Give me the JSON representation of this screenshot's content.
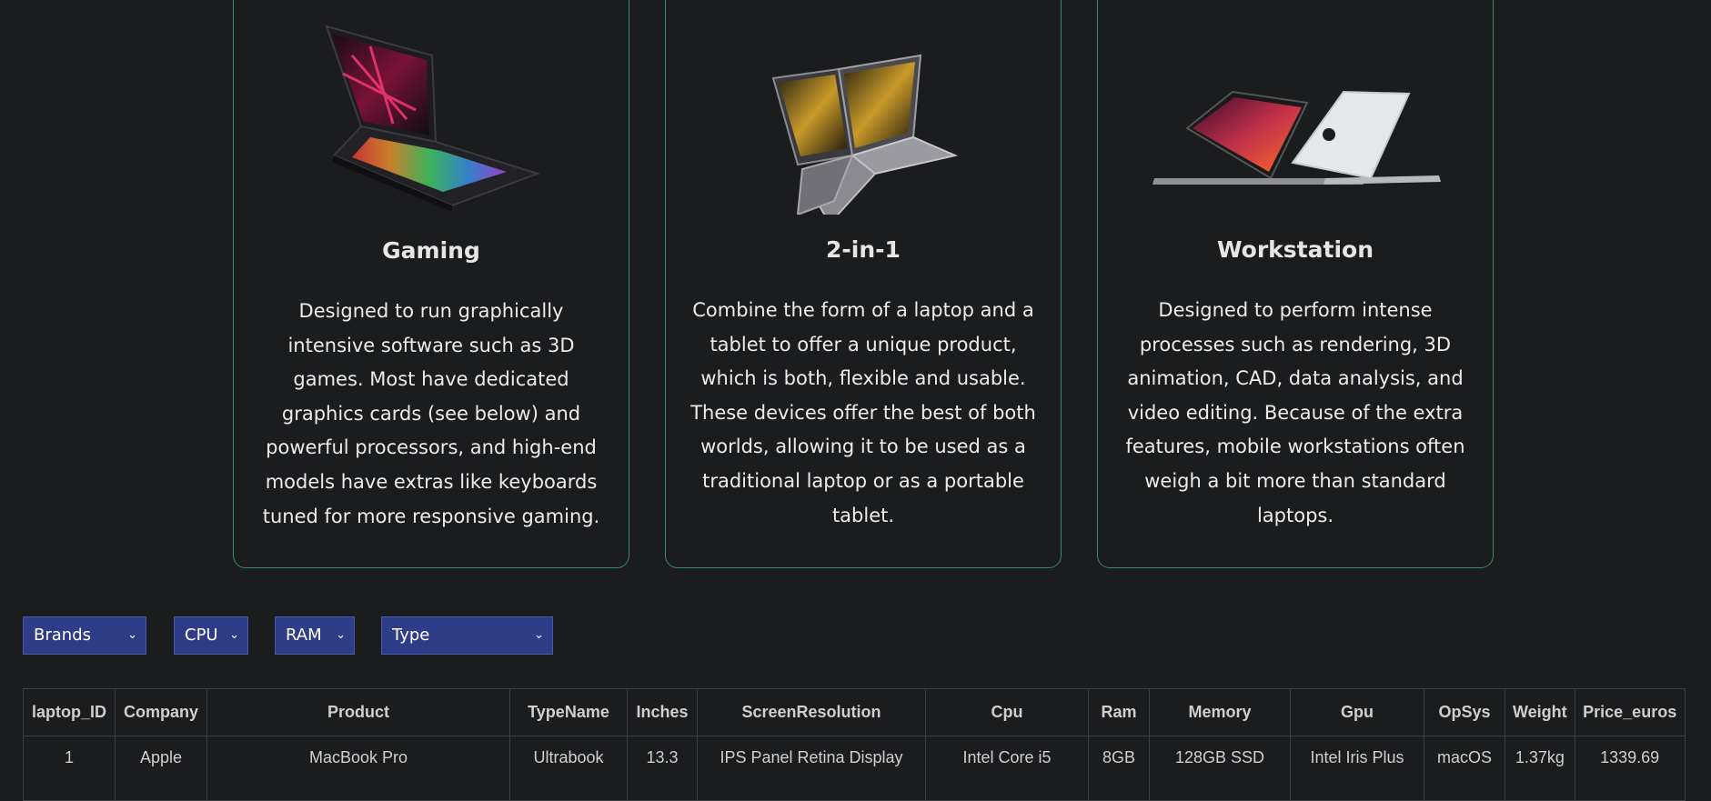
{
  "cards": [
    {
      "title": "Gaming",
      "description": "Designed to run graphically intensive software such as 3D games. Most have dedicated graphics cards (see below) and powerful processors, and high-end models have extras like keyboards tuned for more responsive gaming.",
      "image": "gaming-laptop-image"
    },
    {
      "title": "2-in-1",
      "description": "Combine the form of a laptop and a tablet to offer a unique product, which is both, flexible and usable. These devices offer the best of both worlds, allowing it to be used as a traditional laptop or as a portable tablet.",
      "image": "convertible-laptop-image"
    },
    {
      "title": "Workstation",
      "description": "Designed to perform intense processes such as rendering, 3D animation, CAD, data analysis, and video editing. Because of the extra features, mobile workstations often weigh a bit more than standard laptops.",
      "image": "workstation-laptop-image"
    }
  ],
  "filters": [
    {
      "label": "Brands"
    },
    {
      "label": "CPU"
    },
    {
      "label": "RAM"
    },
    {
      "label": "Type"
    }
  ],
  "table": {
    "columns": [
      "laptop_ID",
      "Company",
      "Product",
      "TypeName",
      "Inches",
      "ScreenResolution",
      "Cpu",
      "Ram",
      "Memory",
      "Gpu",
      "OpSys",
      "Weight",
      "Price_euros"
    ],
    "rows": [
      [
        "1",
        "Apple",
        "MacBook Pro",
        "Ultrabook",
        "13.3",
        "IPS Panel Retina Display",
        "Intel Core i5",
        "8GB",
        "128GB SSD",
        "Intel Iris Plus",
        "macOS",
        "1.37kg",
        "1339.69"
      ]
    ]
  },
  "colors": {
    "background": "#1b1c1e",
    "card_border": "#2f8f6e",
    "select_bg": "#2f3d88"
  }
}
